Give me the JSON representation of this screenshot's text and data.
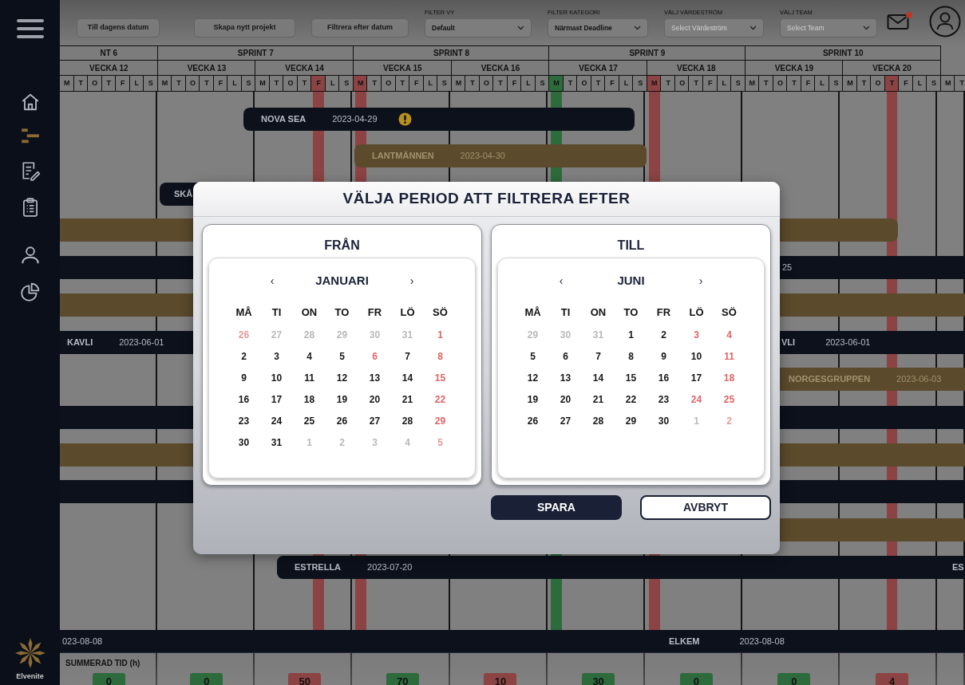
{
  "sidebar": {
    "items": [
      {
        "selected": false
      },
      {
        "selected": true
      },
      {
        "selected": false
      },
      {
        "selected": false
      },
      {
        "selected": false
      },
      {
        "selected": false
      }
    ]
  },
  "logo": {
    "text": "Elvenite"
  },
  "toolbar": {
    "buttons": [
      "Till dagens datum",
      "Skapa nytt projekt",
      "Filtrera efter datum"
    ],
    "filters": [
      {
        "label": "FILTER VY",
        "value": "Default"
      },
      {
        "label": "FILTER KATEGORI",
        "value": "Närmast Deadline"
      },
      {
        "label": "VÄLJ VÄRDESTRÖM",
        "placeholder": "Select Värdeström"
      },
      {
        "label": "VÄLJ TEAM",
        "placeholder": "Select Team"
      }
    ],
    "mail_unread": true
  },
  "sprints": [
    {
      "label": "NT 6",
      "weeks": [
        {
          "label": "VECKA 12",
          "days": [
            {
              "letter": "M"
            },
            {
              "letter": "T"
            },
            {
              "letter": "O"
            },
            {
              "letter": "T"
            },
            {
              "letter": "F"
            },
            {
              "letter": "L"
            },
            {
              "letter": "S"
            }
          ]
        }
      ]
    },
    {
      "label": "SPRINT 7",
      "weeks": [
        {
          "label": "VECKA 13",
          "days": [
            {
              "letter": "M"
            },
            {
              "letter": "T"
            },
            {
              "letter": "O"
            },
            {
              "letter": "T"
            },
            {
              "letter": "F"
            },
            {
              "letter": "L"
            },
            {
              "letter": "S"
            }
          ]
        },
        {
          "label": "VECKA 14",
          "days": [
            {
              "letter": "M"
            },
            {
              "letter": "T"
            },
            {
              "letter": "O"
            },
            {
              "letter": "T"
            },
            {
              "letter": "F",
              "color": "#8c4343"
            },
            {
              "letter": "L"
            },
            {
              "letter": "S"
            }
          ]
        }
      ]
    },
    {
      "label": "SPRINT 8",
      "weeks": [
        {
          "label": "VECKA 15",
          "days": [
            {
              "letter": "M",
              "color": "#8c4343"
            },
            {
              "letter": "T"
            },
            {
              "letter": "O"
            },
            {
              "letter": "T"
            },
            {
              "letter": "F"
            },
            {
              "letter": "L"
            },
            {
              "letter": "S"
            }
          ]
        },
        {
          "label": "VECKA 16",
          "days": [
            {
              "letter": "M"
            },
            {
              "letter": "T"
            },
            {
              "letter": "O"
            },
            {
              "letter": "T"
            },
            {
              "letter": "F"
            },
            {
              "letter": "L"
            },
            {
              "letter": "S"
            }
          ]
        }
      ]
    },
    {
      "label": "SPRINT 9",
      "weeks": [
        {
          "label": "VECKA 17",
          "days": [
            {
              "letter": "M",
              "color": "#2e6b3c"
            },
            {
              "letter": "T"
            },
            {
              "letter": "O"
            },
            {
              "letter": "T"
            },
            {
              "letter": "F"
            },
            {
              "letter": "L"
            },
            {
              "letter": "S"
            }
          ]
        },
        {
          "label": "VECKA 18",
          "days": [
            {
              "letter": "M",
              "color": "#8c4343"
            },
            {
              "letter": "T"
            },
            {
              "letter": "O"
            },
            {
              "letter": "T"
            },
            {
              "letter": "F"
            },
            {
              "letter": "L"
            },
            {
              "letter": "S"
            }
          ]
        }
      ]
    },
    {
      "label": "SPRINT 10",
      "weeks": [
        {
          "label": "VECKA 19",
          "days": [
            {
              "letter": "M"
            },
            {
              "letter": "T"
            },
            {
              "letter": "O"
            },
            {
              "letter": "T"
            },
            {
              "letter": "F"
            },
            {
              "letter": "L"
            },
            {
              "letter": "S"
            }
          ]
        },
        {
          "label": "VECKA 20",
          "days": [
            {
              "letter": "M"
            },
            {
              "letter": "T"
            },
            {
              "letter": "O"
            },
            {
              "letter": "T",
              "color": "#8c4343"
            },
            {
              "letter": "F"
            },
            {
              "letter": "L"
            },
            {
              "letter": "S"
            }
          ]
        }
      ]
    },
    {
      "weeks": [
        {
          "days": [
            {
              "letter": "M"
            },
            {
              "letter": "T"
            }
          ]
        }
      ]
    }
  ],
  "gantt_rows": [
    {
      "color": "#0c111c",
      "labels": [
        {
          "name": "NOVA SEA",
          "date": "2023-04-29",
          "warning": true
        }
      ]
    },
    {
      "color": "#5b4a2c",
      "labels": [
        {
          "name": "LANTMÄNNEN",
          "date": "2023-04-30",
          "warning": false
        }
      ]
    },
    {
      "color": "#0c111c",
      "labels": [
        {
          "name": "SKÅ",
          "warning": false
        }
      ]
    },
    {
      "color": "#5b4a2c"
    },
    {
      "color": "#0c111c",
      "labels": [
        {
          "date": "25",
          "warning": false
        }
      ]
    },
    {
      "color": "#5b4a2c"
    },
    {
      "color": "#0c111c",
      "labels": [
        {
          "name": "KAVLI",
          "date": "2023-06-01",
          "warning": false
        },
        {
          "name": "VLI",
          "date": "2023-06-01",
          "warning": false
        }
      ]
    },
    {
      "color": "#5b4a2c",
      "labels": [
        {
          "name": "NORGESGRUPPEN",
          "date": "2023-06-03",
          "warning": false
        }
      ]
    },
    {
      "color": "#0c111c"
    },
    {
      "color": "#5b4a2c"
    },
    {
      "color": "#0c111c"
    },
    {
      "color": "#5b4a2c"
    },
    {
      "color": "#0c111c",
      "labels": [
        {
          "name": "ESTRELLA",
          "date": "2023-07-20",
          "warning": false
        },
        {
          "name": "ES",
          "warning": false
        }
      ]
    },
    {
      "color": "#0c111c",
      "labels": [
        {
          "date": "023-08-08",
          "warning": false
        },
        {
          "name": "ELKEM",
          "date": "2023-08-08",
          "warning": false
        }
      ]
    }
  ],
  "summary": {
    "label": "SUMMERAD TID (h)",
    "totals": [
      {
        "value": "0",
        "color": "#2e6b3c"
      },
      {
        "value": "0",
        "color": "#2e6b3c"
      },
      {
        "value": "50",
        "color": "#8c4343"
      },
      {
        "value": "70",
        "color": "#2e6b3c"
      },
      {
        "value": "10",
        "color": "#8c4343"
      },
      {
        "value": "30",
        "color": "#2e6b3c"
      },
      {
        "value": "0",
        "color": "#2e6b3c"
      },
      {
        "value": "0",
        "color": "#2e6b3c"
      },
      {
        "value": "4",
        "color": "#8c4343"
      }
    ]
  },
  "date_filter_dialog": {
    "title": "VÄLJA PERIOD ATT FILTRERA EFTER",
    "panels": [
      {
        "heading": "FRÅN",
        "prev": "‹",
        "month": "JANUARI",
        "next": "›",
        "weekdays": [
          "MÅ",
          "TI",
          "ON",
          "TO",
          "FR",
          "LÖ",
          "SÖ"
        ],
        "weeks": [
          [
            {
              "d": "26",
              "outside": true,
              "red": true
            },
            {
              "d": "27",
              "outside": true,
              "red": false
            },
            {
              "d": "28",
              "outside": true,
              "red": false
            },
            {
              "d": "29",
              "outside": true,
              "red": false
            },
            {
              "d": "30",
              "outside": true,
              "red": false
            },
            {
              "d": "31",
              "outside": true,
              "red": false
            },
            {
              "d": "1",
              "outside": false,
              "red": true
            }
          ],
          [
            {
              "d": "2",
              "outside": false,
              "red": false
            },
            {
              "d": "3",
              "outside": false,
              "red": false
            },
            {
              "d": "4",
              "outside": false,
              "red": false
            },
            {
              "d": "5",
              "outside": false,
              "red": false
            },
            {
              "d": "6",
              "outside": false,
              "red": true
            },
            {
              "d": "7",
              "outside": false,
              "red": false
            },
            {
              "d": "8",
              "outside": false,
              "red": true
            }
          ],
          [
            {
              "d": "9",
              "outside": false,
              "red": false
            },
            {
              "d": "10",
              "outside": false,
              "red": false
            },
            {
              "d": "11",
              "outside": false,
              "red": false
            },
            {
              "d": "12",
              "outside": false,
              "red": false
            },
            {
              "d": "13",
              "outside": false,
              "red": false
            },
            {
              "d": "14",
              "outside": false,
              "red": false
            },
            {
              "d": "15",
              "outside": false,
              "red": true
            }
          ],
          [
            {
              "d": "16",
              "outside": false,
              "red": false
            },
            {
              "d": "17",
              "outside": false,
              "red": false
            },
            {
              "d": "18",
              "outside": false,
              "red": false
            },
            {
              "d": "19",
              "outside": false,
              "red": false
            },
            {
              "d": "20",
              "outside": false,
              "red": false
            },
            {
              "d": "21",
              "outside": false,
              "red": false
            },
            {
              "d": "22",
              "outside": false,
              "red": true
            }
          ],
          [
            {
              "d": "23",
              "outside": false,
              "red": false
            },
            {
              "d": "24",
              "outside": false,
              "red": false
            },
            {
              "d": "25",
              "outside": false,
              "red": false
            },
            {
              "d": "26",
              "outside": false,
              "red": false
            },
            {
              "d": "27",
              "outside": false,
              "red": false
            },
            {
              "d": "28",
              "outside": false,
              "red": false
            },
            {
              "d": "29",
              "outside": false,
              "red": true
            }
          ],
          [
            {
              "d": "30",
              "outside": false,
              "red": false
            },
            {
              "d": "31",
              "outside": false,
              "red": false
            },
            {
              "d": "1",
              "outside": true,
              "red": false
            },
            {
              "d": "2",
              "outside": true,
              "red": false
            },
            {
              "d": "3",
              "outside": true,
              "red": false
            },
            {
              "d": "4",
              "outside": true,
              "red": false
            },
            {
              "d": "5",
              "outside": true,
              "red": true
            }
          ]
        ]
      },
      {
        "heading": "TILL",
        "prev": "‹",
        "month": "JUNI",
        "next": "›",
        "weekdays": [
          "MÅ",
          "TI",
          "ON",
          "TO",
          "FR",
          "LÖ",
          "SÖ"
        ],
        "weeks": [
          [
            {
              "d": "29",
              "outside": true,
              "red": false
            },
            {
              "d": "30",
              "outside": true,
              "red": false
            },
            {
              "d": "31",
              "outside": true,
              "red": false
            },
            {
              "d": "1",
              "outside": false,
              "red": false
            },
            {
              "d": "2",
              "outside": false,
              "red": false
            },
            {
              "d": "3",
              "outside": false,
              "red": true
            },
            {
              "d": "4",
              "outside": false,
              "red": true
            }
          ],
          [
            {
              "d": "5",
              "outside": false,
              "red": false
            },
            {
              "d": "6",
              "outside": false,
              "red": false
            },
            {
              "d": "7",
              "outside": false,
              "red": false
            },
            {
              "d": "8",
              "outside": false,
              "red": false
            },
            {
              "d": "9",
              "outside": false,
              "red": false
            },
            {
              "d": "10",
              "outside": false,
              "red": false
            },
            {
              "d": "11",
              "outside": false,
              "red": true
            }
          ],
          [
            {
              "d": "12",
              "outside": false,
              "red": false
            },
            {
              "d": "13",
              "outside": false,
              "red": false
            },
            {
              "d": "14",
              "outside": false,
              "red": false
            },
            {
              "d": "15",
              "outside": false,
              "red": false
            },
            {
              "d": "16",
              "outside": false,
              "red": false
            },
            {
              "d": "17",
              "outside": false,
              "red": false
            },
            {
              "d": "18",
              "outside": false,
              "red": true
            }
          ],
          [
            {
              "d": "19",
              "outside": false,
              "red": false
            },
            {
              "d": "20",
              "outside": false,
              "red": false
            },
            {
              "d": "21",
              "outside": false,
              "red": false
            },
            {
              "d": "22",
              "outside": false,
              "red": false
            },
            {
              "d": "23",
              "outside": false,
              "red": false
            },
            {
              "d": "24",
              "outside": false,
              "red": true
            },
            {
              "d": "25",
              "outside": false,
              "red": true
            }
          ],
          [
            {
              "d": "26",
              "outside": false,
              "red": false
            },
            {
              "d": "27",
              "outside": false,
              "red": false
            },
            {
              "d": "28",
              "outside": false,
              "red": false
            },
            {
              "d": "29",
              "outside": false,
              "red": false
            },
            {
              "d": "30",
              "outside": false,
              "red": false
            },
            {
              "d": "1",
              "outside": true,
              "red": false
            },
            {
              "d": "2",
              "outside": true,
              "red": true
            }
          ]
        ]
      }
    ],
    "buttons": [
      {
        "label": "SPARA",
        "kind": "primary"
      },
      {
        "label": "AVBRYT",
        "kind": "secondary"
      }
    ]
  }
}
